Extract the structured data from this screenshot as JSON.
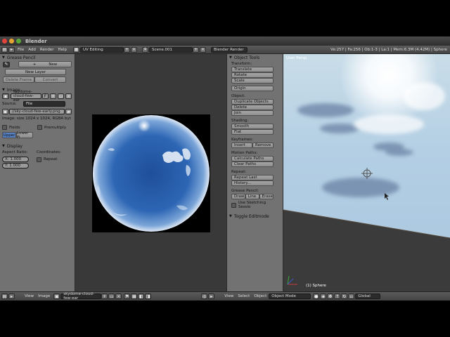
{
  "window": {
    "title": "Blender"
  },
  "header": {
    "menus": [
      "File",
      "Add",
      "Render",
      "Help"
    ],
    "screen_layout": "UV Editing",
    "scene": "Scene.001",
    "render_engine": "Blender Render",
    "stats": "Ve:257 | Fa:256 | Ob:1-3 | La:1 | Mem:6.3M (4.42M) | Sphere"
  },
  "left_panel": {
    "grease_pencil": {
      "title": "Grease Pencil",
      "new_label": "New",
      "new_layer_label": "New Layer",
      "delete_frame_label": "Delete Frame",
      "convert_label": "Convert"
    },
    "image": {
      "title": "Image",
      "image_name": "skydome-cloud-few-ear",
      "f_label": "F",
      "source_label": "Source:",
      "source_value": "File",
      "filepath": "//sky-cloud-few-early.png",
      "info": "Image: size 1024 x 1024, RGBA byt",
      "fields_label": "Fields",
      "premultiply_label": "Premultiply",
      "tab_upper": "Upper",
      "tab_lower": "Lower Fi"
    },
    "display": {
      "title": "Display",
      "aspect_label": "Aspect Ratio:",
      "coords_label": "Coordinates:",
      "x_value": "X: 1.000",
      "y_value": "Y: 1.000",
      "repeat_label": "Repeat"
    }
  },
  "tool_shelf": {
    "title": "Object Tools",
    "transform_label": "Transform:",
    "translate": "Translate",
    "rotate": "Rotate",
    "scale": "Scale",
    "origin": "Origin",
    "object_label": "Object:",
    "duplicate": "Duplicate Objects",
    "delete": "Delete",
    "join": "Join",
    "shading_label": "Shading:",
    "smooth": "Smooth",
    "flat": "Flat",
    "keyframes_label": "Keyframes:",
    "insert": "Insert",
    "remove": "Remove",
    "motion_paths_label": "Motion Paths:",
    "calculate_paths": "Calculate Paths",
    "clear_paths": "Clear Paths",
    "repeat_label": "Repeat:",
    "repeat_last": "Repeat Last",
    "history": "History...",
    "grease_pencil_label": "Grease Pencil:",
    "draw": "Draw",
    "line": "Line",
    "erase": "Erase",
    "use_sketching": "Use Sketching Sessio",
    "toggle_editmode": "Toggle Editmode"
  },
  "viewport": {
    "view_label": "User Persp",
    "object_label": "(1) Sphere"
  },
  "bottom_bar": {
    "view": "View",
    "image": "Image",
    "image_name": "skydome-cloud-few-ear",
    "view2": "View",
    "select": "Select",
    "object": "Object",
    "mode": "Object Mode",
    "orientation": "Global"
  },
  "colors": {
    "panel_bg": "#727272",
    "editor_bg": "#393939",
    "header_bg": "#4d4d4d",
    "selection_blue": "#5680c2"
  }
}
